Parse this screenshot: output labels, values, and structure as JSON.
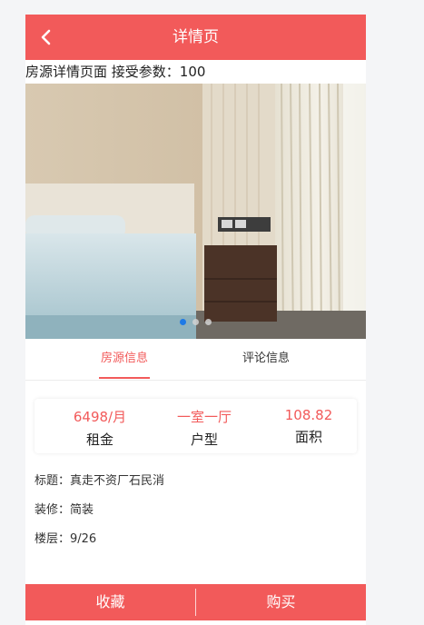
{
  "navbar": {
    "title": "详情页"
  },
  "param_line": "房源详情页面 接受参数：100",
  "carousel": {
    "active_index": 0,
    "count": 3
  },
  "tabs": [
    {
      "label": "房源信息",
      "active": true
    },
    {
      "label": "评论信息",
      "active": false
    }
  ],
  "stats": [
    {
      "value": "6498/月",
      "label": "租金"
    },
    {
      "value": "一室一厅",
      "label": "户型"
    },
    {
      "value": "108.82",
      "label": "面积"
    }
  ],
  "details": [
    {
      "text": "标题：真走不资厂石民消"
    },
    {
      "text": "装修：简装"
    },
    {
      "text": "楼层：9/26"
    }
  ],
  "bottom_bar": {
    "favorite_label": "收藏",
    "buy_label": "购买"
  },
  "colors": {
    "accent": "#f25a5a",
    "dot_active": "#1e7ae6"
  }
}
